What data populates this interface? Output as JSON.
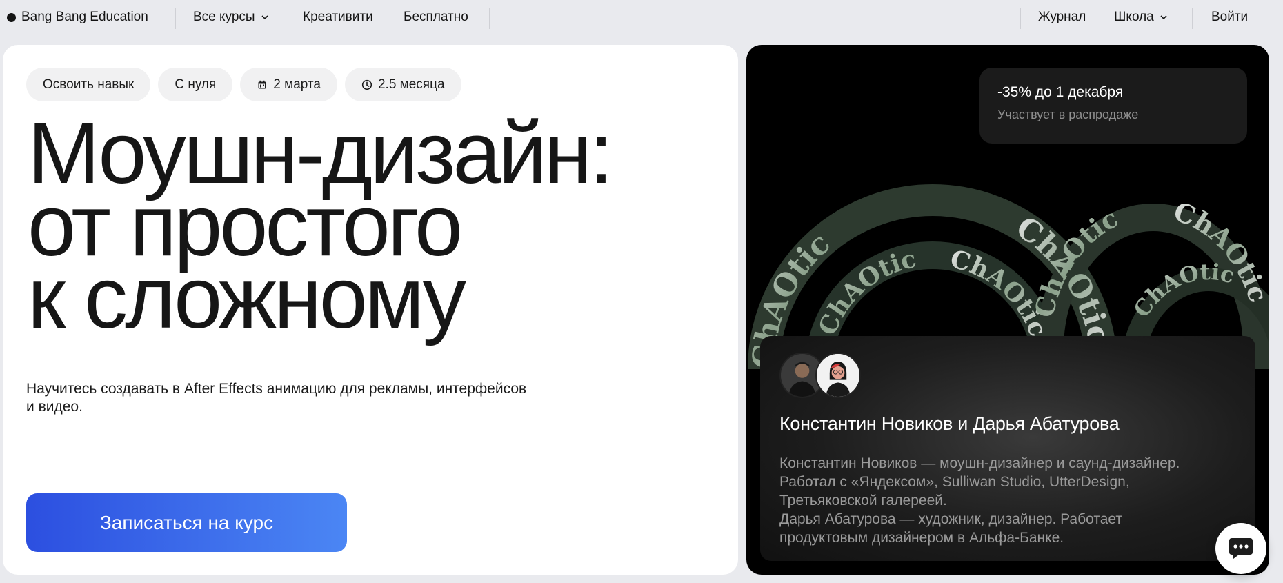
{
  "nav": {
    "brand": "Bang Bang Education",
    "courses": "Все курсы",
    "creativity": "Креативити",
    "free": "Бесплатно",
    "journal": "Журнал",
    "school": "Школа",
    "login": "Войти"
  },
  "hero": {
    "chips": [
      "Освоить навык",
      "С нуля",
      "2 марта",
      "2.5 месяца"
    ],
    "title_lines": [
      "Моушн-дизайн:",
      "от простого",
      "к сложному"
    ],
    "lead_1": "Научитесь создавать в After Effects анимацию для рекламы, интерфейсов",
    "lead_2": "и видео.",
    "cta": "Записаться на курс"
  },
  "promo": {
    "sale_title": "-35% до 1 декабря",
    "sale_subtitle": "Участвует в распродаже",
    "artwork_text": "ChAOtic",
    "teachers_name": "Константин Новиков и Дарья Абатурова",
    "bio_lines": [
      "Константин Новиков — моушн-дизайнер и саунд-дизайнер.",
      "Работал с «Яндексом», Sulliwan Studio, UtterDesign,",
      "Третьяковской галереей.",
      "Дарья Абатурова — художник, дизайнер. Работает",
      "продуктовым дизайнером в Альфа-Банке."
    ]
  },
  "icons": {
    "calendar": "calendar-icon",
    "clock": "clock-icon",
    "chevron": "chevron-down-icon",
    "chat": "chat-icon"
  },
  "colors": {
    "page_bg": "#e9eaee",
    "cta_start": "#2c4fe0",
    "cta_end": "#4b86f4",
    "promo_bg": "#000000"
  }
}
